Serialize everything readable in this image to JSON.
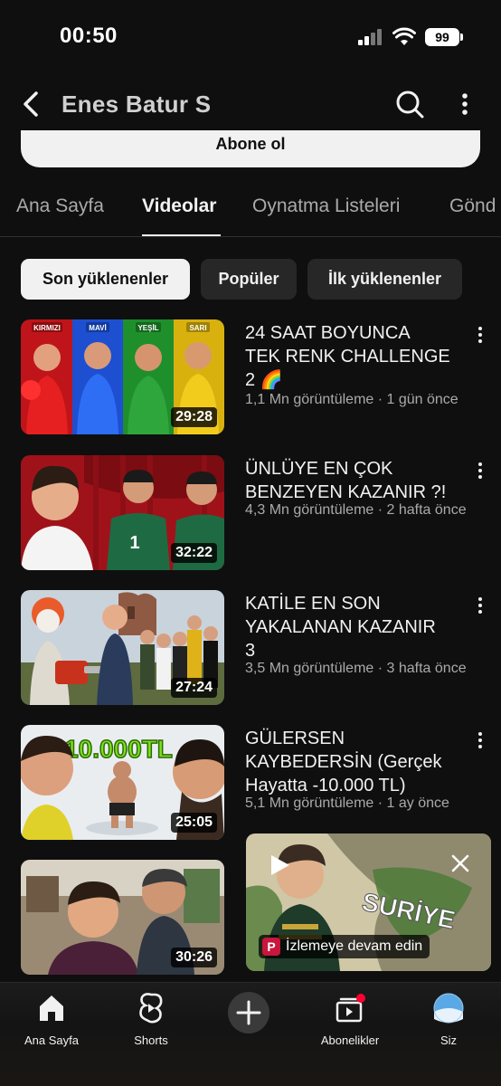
{
  "status": {
    "time": "00:50",
    "battery": "99"
  },
  "header": {
    "title": "Enes Batur S"
  },
  "subscribe": {
    "label": "Abone ol"
  },
  "tabs": [
    {
      "label": "Ana Sayfa"
    },
    {
      "label": "Videolar"
    },
    {
      "label": "Oynatma Listeleri"
    },
    {
      "label": "Gönd"
    }
  ],
  "chips": [
    {
      "label": "Son yüklenenler"
    },
    {
      "label": "Popüler"
    },
    {
      "label": "İlk yüklenenler"
    }
  ],
  "videos": [
    {
      "title_lines": [
        "24 SAAT BOYUNCA",
        "TEK RENK CHALLENGE",
        "2 🌈"
      ],
      "meta": "1,1 Mn görüntüleme · 1 gün önce",
      "duration": "29:28",
      "thumb_labels": [
        "KIRMIZI",
        "MAVİ",
        "YEŞİL",
        "SARI"
      ]
    },
    {
      "title_lines": [
        "ÜNLÜYE EN ÇOK",
        "BENZEYEN KAZANIR ?!"
      ],
      "meta": "4,3 Mn görüntüleme · 2 hafta önce",
      "duration": "32:22"
    },
    {
      "title_lines": [
        "KATİLE EN SON",
        "YAKALANAN KAZANIR",
        "3"
      ],
      "meta": "3,5 Mn görüntüleme · 3 hafta önce",
      "duration": "27:24"
    },
    {
      "title_lines": [
        "GÜLERSEN",
        "KAYBEDERSİN (Gerçek",
        "Hayatta -10.000 TL)"
      ],
      "meta": "5,1 Mn görüntüleme · 1 ay önce",
      "duration": "25:05",
      "thumb_text": "10.000TL"
    },
    {
      "duration": "30:26"
    }
  ],
  "mini_player": {
    "label": "İzlemeye devam edin",
    "badge": "P",
    "overlay_text": "SURİYE"
  },
  "bottom_nav": [
    {
      "label": "Ana Sayfa"
    },
    {
      "label": "Shorts"
    },
    {
      "label": "Abonelikler"
    },
    {
      "label": "Siz"
    }
  ],
  "colors": {
    "background": "#0f0f0f",
    "text": "#f1f1f1",
    "secondary_text": "#aaaaaa",
    "chip": "#272727",
    "notification": "#ff0033"
  }
}
